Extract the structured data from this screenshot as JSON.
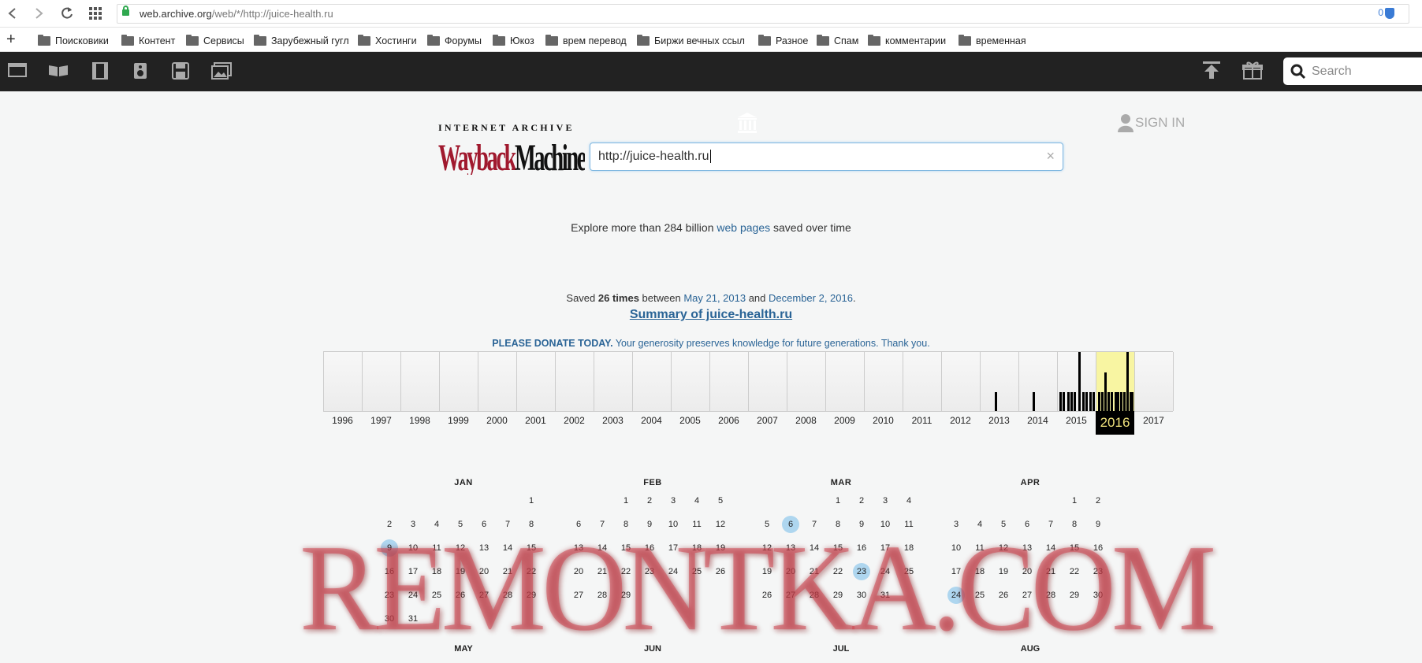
{
  "browser": {
    "url_host": "web.archive.org",
    "url_path": "/web/*/http://juice-health.ru",
    "extension_badge": "0",
    "bookmarks": [
      "Поисковики",
      "Контент",
      "Сервисы",
      "Зарубежный гугл",
      "Хостинги",
      "Форумы",
      "Юкоз",
      "врем перевод",
      "Биржи вечных ссыл",
      "Разное",
      "Спам",
      "комментарии",
      "временная"
    ]
  },
  "iabar": {
    "icons": [
      "web-icon",
      "texts-icon",
      "video-icon",
      "audio-icon",
      "software-icon",
      "images-icon"
    ],
    "sign_in": "SIGN IN",
    "search_placeholder": "Search"
  },
  "wayback": {
    "logo_top": "INTERNET ARCHIVE",
    "logo_main": "WaybackMachine",
    "input_value": "http://juice-health.ru",
    "clear": "×",
    "explore_pre": "Explore more than 284 billion ",
    "explore_link": "web pages",
    "explore_post": " saved over time",
    "saved_pre": "Saved ",
    "saved_count": "26 times",
    "saved_mid": " between ",
    "saved_from": "May 21, 2013",
    "saved_and": " and ",
    "saved_to": "December 2, 2016",
    "saved_end": ".",
    "summary": "Summary of juice-health.ru",
    "donate_bold": "PLEASE DONATE TODAY.",
    "donate_text": " Your generosity preserves knowledge for future generations. Thank you."
  },
  "chart_data": {
    "type": "bar",
    "categories": [
      "1996",
      "1997",
      "1998",
      "1999",
      "2000",
      "2001",
      "2002",
      "2003",
      "2004",
      "2005",
      "2006",
      "2007",
      "2008",
      "2009",
      "2010",
      "2011",
      "2012",
      "2013",
      "2014",
      "2015",
      "2016",
      "2017"
    ],
    "selected_year": "2016",
    "captures_per_year": [
      0,
      0,
      0,
      0,
      0,
      0,
      0,
      0,
      0,
      0,
      0,
      0,
      0,
      0,
      0,
      0,
      0,
      1,
      1,
      8,
      16,
      0
    ],
    "title": "",
    "xlabel": "",
    "ylabel": ""
  },
  "calendar": {
    "months": [
      {
        "name": "JAN",
        "start": 6,
        "days": 31,
        "snaps": [
          9
        ]
      },
      {
        "name": "FEB",
        "start": 2,
        "days": 29,
        "snaps": []
      },
      {
        "name": "MAR",
        "start": 3,
        "days": 31,
        "snaps": [
          6,
          23
        ]
      },
      {
        "name": "APR",
        "start": 5,
        "days": 30,
        "snaps": [
          24
        ]
      }
    ],
    "next_months": [
      "MAY",
      "JUN",
      "JUL",
      "AUG"
    ]
  },
  "watermark": "REMONTKA.COM"
}
